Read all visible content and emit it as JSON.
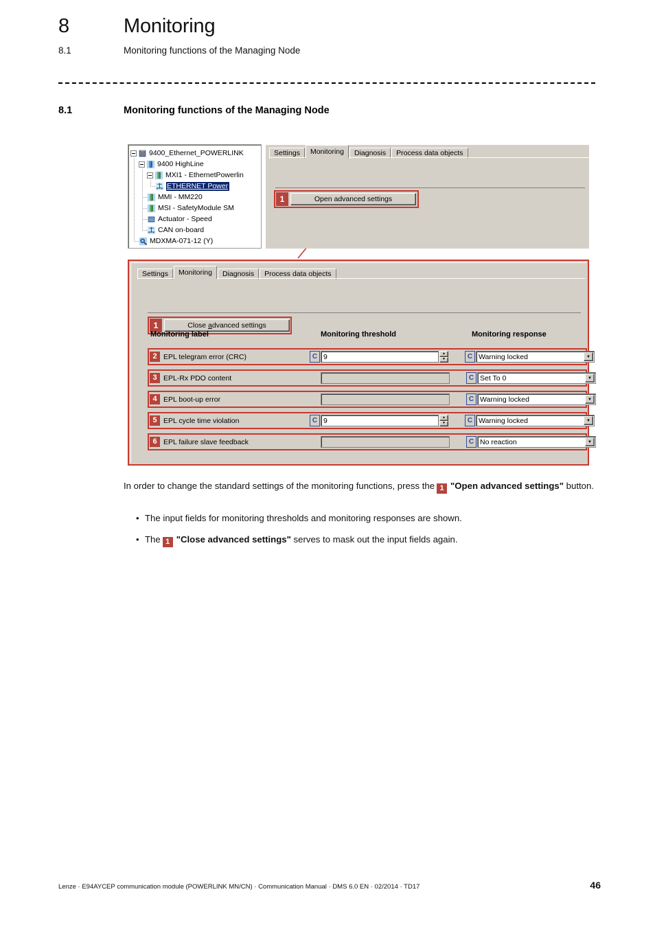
{
  "header": {
    "chapter_number": "8",
    "chapter_title": "Monitoring",
    "section_number": "8.1",
    "section_title": "Monitoring functions of the Managing Node"
  },
  "section": {
    "number": "8.1",
    "title": "Monitoring functions of the Managing Node"
  },
  "figure": {
    "tree": {
      "nodes": [
        {
          "label": "9400_Ethernet_POWERLINK",
          "icon": "project-icon",
          "depth": 0,
          "expanded": true,
          "selected": false
        },
        {
          "label": "9400 HighLine",
          "icon": "device-icon",
          "depth": 1,
          "expanded": true,
          "selected": false
        },
        {
          "label": "MXI1 - EthernetPowerlin",
          "icon": "module-icon",
          "depth": 2,
          "expanded": true,
          "selected": false
        },
        {
          "label": "ETHERNET Power",
          "icon": "bus-icon",
          "depth": 3,
          "expanded": false,
          "selected": true
        },
        {
          "label": "MMI - MM220",
          "icon": "module-icon",
          "depth": 2,
          "expanded": false,
          "selected": false
        },
        {
          "label": "MSI - SafetyModule SM",
          "icon": "module-icon",
          "depth": 2,
          "expanded": false,
          "selected": false
        },
        {
          "label": "Actuator - Speed",
          "icon": "actuator-icon",
          "depth": 2,
          "expanded": false,
          "selected": false
        },
        {
          "label": "CAN on-board",
          "icon": "bus-icon",
          "depth": 2,
          "expanded": false,
          "selected": false
        },
        {
          "label": "MDXMA-071-12 (Y)",
          "icon": "motor-icon",
          "depth": 1,
          "expanded": false,
          "selected": false
        }
      ]
    },
    "upper_panel": {
      "tabs": [
        {
          "label": "Settings",
          "active": false
        },
        {
          "label": "Monitoring",
          "active": true
        },
        {
          "label": "Diagnosis",
          "active": false
        },
        {
          "label": "Process data objects",
          "active": false
        }
      ],
      "callout_number": "1",
      "button_label": "Open advanced settings"
    },
    "lower_panel": {
      "tabs": [
        {
          "label": "Settings",
          "active": false
        },
        {
          "label": "Monitoring",
          "active": true
        },
        {
          "label": "Diagnosis",
          "active": false
        },
        {
          "label": "Process data objects",
          "active": false
        }
      ],
      "callout_number": "1",
      "button_label_pre": "Close ",
      "button_label_accel": "a",
      "button_label_post": "dvanced settings",
      "button_label": "Close advanced settings",
      "columns": {
        "label": "Monitoring label",
        "threshold": "Monitoring threshold",
        "response": "Monitoring response"
      },
      "parameter_button_label": "C",
      "rows": [
        {
          "number": "2",
          "label": "EPL telegram error (CRC)",
          "threshold_enabled": true,
          "threshold_value": "9",
          "has_spinner": true,
          "response": "Warning locked"
        },
        {
          "number": "3",
          "label": "EPL-Rx PDO content",
          "threshold_enabled": false,
          "threshold_value": "",
          "has_spinner": false,
          "response": "Set To 0"
        },
        {
          "number": "4",
          "label": "EPL boot-up error",
          "threshold_enabled": false,
          "threshold_value": "",
          "has_spinner": false,
          "response": "Warning locked"
        },
        {
          "number": "5",
          "label": "EPL cycle time violation",
          "threshold_enabled": true,
          "threshold_value": "9",
          "has_spinner": true,
          "response": "Warning locked"
        },
        {
          "number": "6",
          "label": "EPL failure slave feedback",
          "threshold_enabled": false,
          "threshold_value": "",
          "has_spinner": false,
          "response": "No reaction"
        }
      ]
    }
  },
  "body": {
    "paragraph_part1": "In order to change the standard settings of the monitoring functions, press the",
    "paragraph_badge": "1",
    "paragraph_bold": "\"Open advanced settings\"",
    "paragraph_part2": " button.",
    "bullets": [
      {
        "text_before": "The input fields for monitoring thresholds and monitoring responses are shown.",
        "badge": "",
        "bold": "",
        "text_after": ""
      },
      {
        "text_before": "The",
        "badge": "1",
        "bold": "\"Close advanced settings\"",
        "text_after": " serves to mask out the input fields again."
      }
    ]
  },
  "footer": {
    "text": "Lenze · E94AYCEP communication module (POWERLINK MN/CN) · Communication Manual · DMS 6.0 EN · 02/2014 · TD17",
    "page_number": "46"
  },
  "colors": {
    "annotation_red": "#c8382f",
    "badge_red": "#b4453c",
    "window_face": "#d4d0c8",
    "selection_blue": "#0a246a",
    "parameter_blue": "#2b4b9b"
  }
}
